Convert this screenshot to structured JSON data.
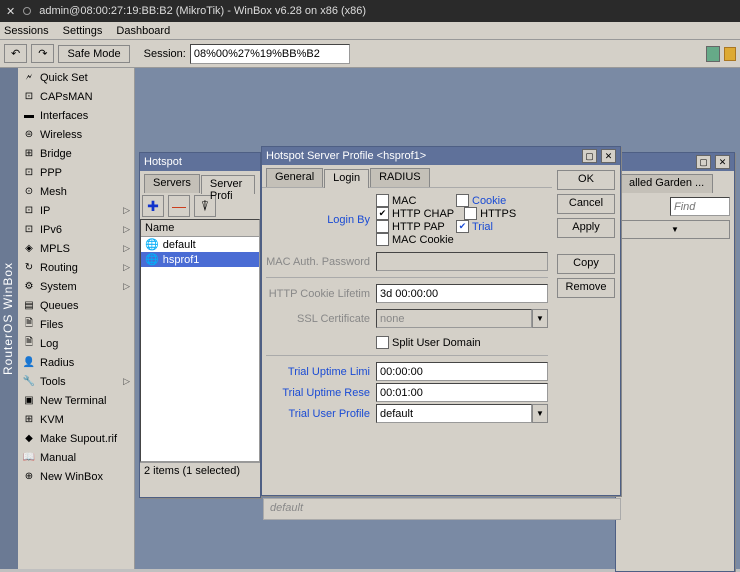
{
  "title": "admin@08:00:27:19:BB:B2 (MikroTik) - WinBox v6.28 on x86 (x86)",
  "menubar": [
    "Sessions",
    "Settings",
    "Dashboard"
  ],
  "toolbar": {
    "undo": "↶",
    "redo": "↷",
    "safemode": "Safe Mode",
    "session_label": "Session:",
    "session_value": "08%00%27%19%BB%B2"
  },
  "side_label": "RouterOS WinBox",
  "nav": [
    {
      "icon": "🗲",
      "label": "Quick Set",
      "caret": false
    },
    {
      "icon": "⊡",
      "label": "CAPsMAN",
      "caret": false
    },
    {
      "icon": "▬",
      "label": "Interfaces",
      "caret": false
    },
    {
      "icon": "⊜",
      "label": "Wireless",
      "caret": false
    },
    {
      "icon": "⊞",
      "label": "Bridge",
      "caret": false
    },
    {
      "icon": "⊡",
      "label": "PPP",
      "caret": false
    },
    {
      "icon": "⊙",
      "label": "Mesh",
      "caret": false
    },
    {
      "icon": "⊡",
      "label": "IP",
      "caret": true
    },
    {
      "icon": "⊡",
      "label": "IPv6",
      "caret": true
    },
    {
      "icon": "◈",
      "label": "MPLS",
      "caret": true
    },
    {
      "icon": "↻",
      "label": "Routing",
      "caret": true
    },
    {
      "icon": "⚙",
      "label": "System",
      "caret": true
    },
    {
      "icon": "▤",
      "label": "Queues",
      "caret": false
    },
    {
      "icon": "🗎",
      "label": "Files",
      "caret": false
    },
    {
      "icon": "🗎",
      "label": "Log",
      "caret": false
    },
    {
      "icon": "👤",
      "label": "Radius",
      "caret": false
    },
    {
      "icon": "🔧",
      "label": "Tools",
      "caret": true
    },
    {
      "icon": "▣",
      "label": "New Terminal",
      "caret": false
    },
    {
      "icon": "⊞",
      "label": "KVM",
      "caret": false
    },
    {
      "icon": "◆",
      "label": "Make Supout.rif",
      "caret": false
    },
    {
      "icon": "📖",
      "label": "Manual",
      "caret": false
    },
    {
      "icon": "⊕",
      "label": "New WinBox",
      "caret": false
    }
  ],
  "win_back": {
    "tabs_partial": "alled Garden ...",
    "find": "Find"
  },
  "win_hotspot": {
    "title": "Hotspot",
    "tabs": [
      "Servers",
      "Server Profi"
    ],
    "tool_add": "✚",
    "tool_del": "—",
    "tool_filter": "⍒",
    "list_head": "Name",
    "rows": [
      {
        "icon": "🌐",
        "name": "default",
        "sel": false
      },
      {
        "icon": "🌐",
        "name": "hsprof1",
        "sel": true
      }
    ],
    "status": "2 items (1 selected)",
    "footer_text": "default"
  },
  "win_profile": {
    "title": "Hotspot Server Profile <hsprof1>",
    "tabs": [
      "General",
      "Login",
      "RADIUS"
    ],
    "btns": [
      "OK",
      "Cancel",
      "Apply",
      "Copy",
      "Remove"
    ],
    "login_by": "Login By",
    "cbs": [
      {
        "label": "MAC",
        "checked": false,
        "blue": false
      },
      {
        "label": "Cookie",
        "checked": false,
        "blue": true
      },
      {
        "label": "HTTP CHAP",
        "checked": true,
        "blue": false
      },
      {
        "label": "HTTPS",
        "checked": false,
        "blue": false
      },
      {
        "label": "HTTP PAP",
        "checked": false,
        "blue": false
      },
      {
        "label": "Trial",
        "checked": true,
        "blue": true
      },
      {
        "label": "MAC Cookie",
        "checked": false,
        "blue": false
      }
    ],
    "mac_pw": "MAC Auth. Password",
    "cookie_life_label": "HTTP Cookie Lifetim",
    "cookie_life": "3d 00:00:00",
    "ssl_label": "SSL Certificate",
    "ssl": "none",
    "split": "Split User Domain",
    "split_checked": false,
    "trial_limit_label": "Trial Uptime Limi",
    "trial_limit": "00:00:00",
    "trial_reset_label": "Trial Uptime Rese",
    "trial_reset": "00:01:00",
    "trial_profile_label": "Trial User Profile",
    "trial_profile": "default"
  }
}
